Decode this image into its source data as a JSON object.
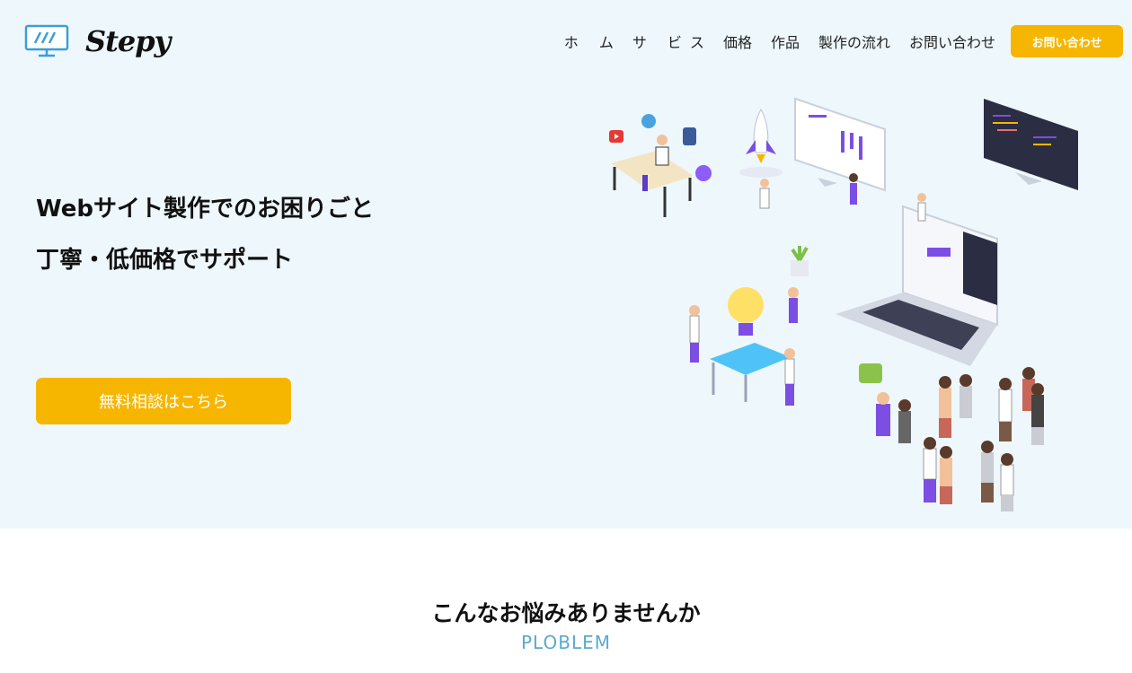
{
  "brand": {
    "name": "Stepy"
  },
  "nav": {
    "items": [
      {
        "label": "ホ ム",
        "name": "nav-home"
      },
      {
        "label": "サ ビス",
        "name": "nav-service"
      },
      {
        "label": "価格",
        "name": "nav-price"
      },
      {
        "label": "作品",
        "name": "nav-works"
      },
      {
        "label": "製作の流れ",
        "name": "nav-flow"
      },
      {
        "label": "お問い合わせ",
        "name": "nav-contact"
      }
    ],
    "cta_label": "お問い合わせ"
  },
  "hero": {
    "headline_line1": "Webサイト製作でのお困りごと",
    "headline_line2": "丁寧・低価格でサポート",
    "cta_label": "無料相談はこちら",
    "illustration": "isometric-team-web-development-illustration"
  },
  "problem": {
    "title": "こんなお悩みありませんか",
    "subtitle": "PLOBLEM"
  },
  "colors": {
    "hero_bg": "#eef7fc",
    "accent": "#f6b600",
    "subtitle": "#5aa9cf"
  }
}
